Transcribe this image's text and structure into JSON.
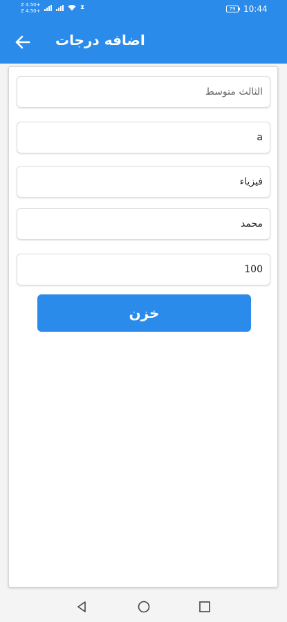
{
  "status_bar": {
    "carrier_line1": "Z 4.50+",
    "carrier_line2": "Z 4.50+",
    "battery": "79",
    "time": "10:44"
  },
  "app_bar": {
    "title": "اضافه درجات"
  },
  "form": {
    "fields": [
      {
        "name": "class-field",
        "value": "",
        "placeholder": "الثالث متوسط"
      },
      {
        "name": "section-field",
        "value": "a",
        "placeholder": ""
      },
      {
        "name": "subject-field",
        "value": "فيزياء",
        "placeholder": ""
      },
      {
        "name": "student-name-field",
        "value": "محمد",
        "placeholder": ""
      },
      {
        "name": "grade-field",
        "value": "100",
        "placeholder": ""
      }
    ],
    "save_label": "خزن"
  },
  "icons": {
    "back": "arrow-left-icon",
    "nav_back": "triangle-back-icon",
    "nav_home": "circle-home-icon",
    "nav_recents": "square-recents-icon"
  },
  "colors": {
    "primary": "#2b8bea",
    "background": "#f4f4f4"
  }
}
